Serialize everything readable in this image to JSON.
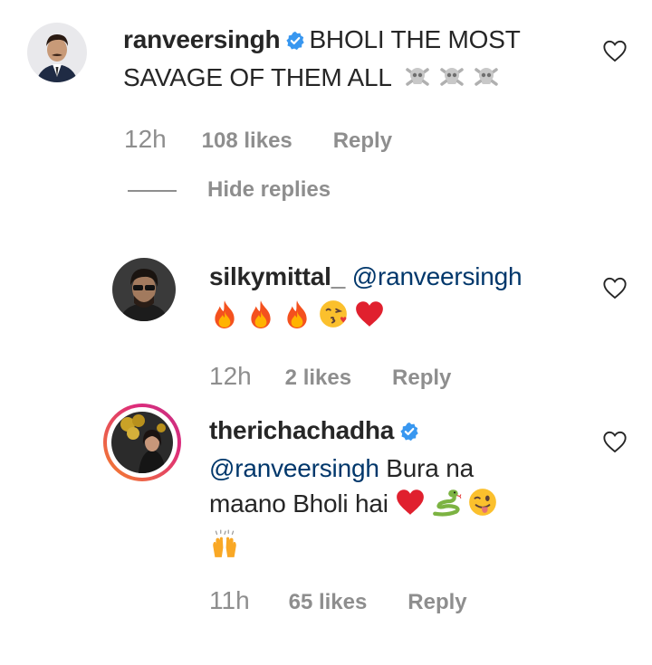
{
  "comments": [
    {
      "username": "ranveersingh",
      "verified": true,
      "text_line1": "BHOLI THE MOST",
      "text_line2": "SAVAGE OF THEM ALL",
      "emojis": [
        "skull-crossbones",
        "skull-crossbones",
        "skull-crossbones"
      ],
      "time": "12h",
      "likes": "108 likes",
      "reply": "Reply"
    },
    {
      "username": "silkymittal_",
      "verified": false,
      "mention": "@ranveersingh",
      "emojis": [
        "fire",
        "fire",
        "fire",
        "face-blowing-kiss",
        "red-heart"
      ],
      "time": "12h",
      "likes": "2 likes",
      "reply": "Reply"
    },
    {
      "username": "therichachadha",
      "verified": true,
      "mention": "@ranveersingh",
      "text_line2a": "Bura na",
      "text_line3": "maano Bholi hai",
      "emojis_line3": [
        "red-heart",
        "snake",
        "winking-face-with-tongue"
      ],
      "emojis_line4": [
        "raising-hands"
      ],
      "time": "11h",
      "likes": "65 likes",
      "reply": "Reply"
    }
  ],
  "thread": {
    "hide_replies": "Hide replies"
  },
  "colors": {
    "text": "#262626",
    "secondary": "#8e8e8e",
    "mention": "#00376b",
    "verified": "#3897f0",
    "story_ring_start": "#f58529",
    "story_ring_end": "#dd2a7b"
  }
}
